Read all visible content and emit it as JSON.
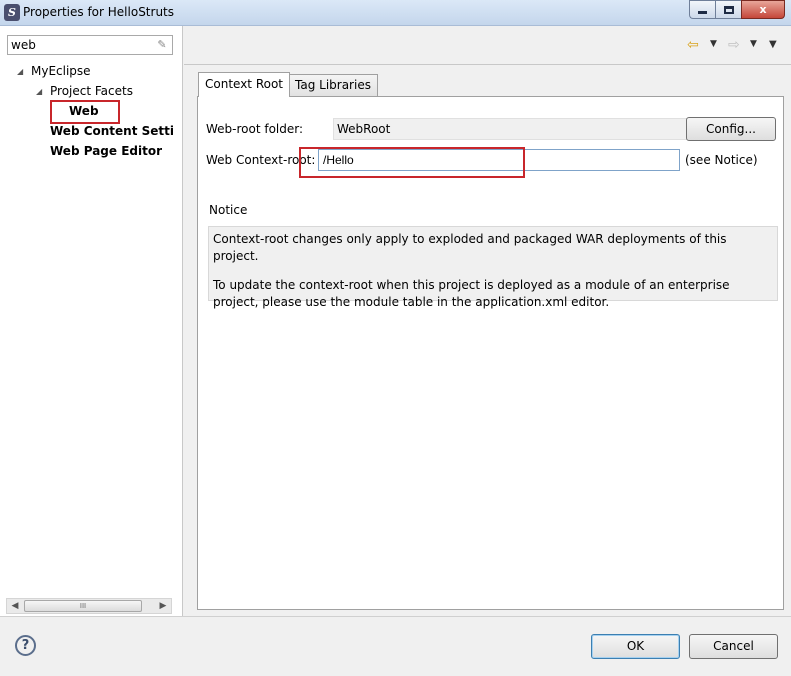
{
  "window": {
    "title": "Properties for HelloStruts",
    "app_icon_glyph": "S",
    "buttons": {
      "minimize": "minimize",
      "maximize": "maximize",
      "close": "x"
    }
  },
  "left": {
    "filter_value": "web",
    "tree": [
      {
        "label": "MyEclipse",
        "level": 0,
        "expanded": true,
        "bold": false
      },
      {
        "label": "Project Facets",
        "level": 1,
        "expanded": true,
        "bold": false
      },
      {
        "label": "Web",
        "level": 2,
        "bold": true,
        "selected": true
      },
      {
        "label": "Web Content Settings",
        "level": 1,
        "bold": true
      },
      {
        "label": "Web Page Editor",
        "level": 1,
        "bold": true
      }
    ],
    "scroll_thumb_glyph": "III"
  },
  "right": {
    "tabs": [
      {
        "label": "Context Root",
        "active": true
      },
      {
        "label": "Tag Libraries",
        "active": false
      }
    ],
    "web_root_label": "Web-root folder:",
    "web_root_value": "WebRoot",
    "config_button": "Config...",
    "context_root_label": "Web Context-root:",
    "context_root_value": "/Hello",
    "see_notice": "(see Notice)",
    "notice_title": "Notice",
    "notice_line1": "Context-root changes only apply to exploded and packaged WAR deployments of this project.",
    "notice_line2": "To update the context-root when this project is deployed as a module of an enterprise project, please use the module table in the application.xml editor."
  },
  "footer": {
    "help_glyph": "?",
    "ok": "OK",
    "cancel": "Cancel"
  },
  "colors": {
    "highlight_red": "#c8262b",
    "title_bar": "#c4d6ec",
    "close_red": "#c5473a"
  }
}
